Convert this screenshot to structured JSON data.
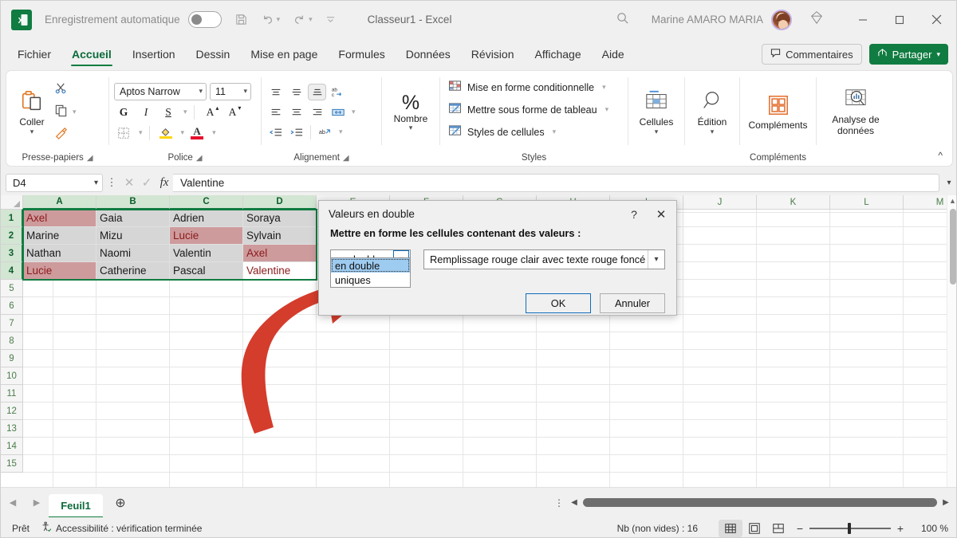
{
  "titlebar": {
    "app_icon": "excel-logo",
    "autosave_label": "Enregistrement automatique",
    "autosave_state": "off",
    "save_icon": "save-icon",
    "undo_icon": "undo-icon",
    "redo_icon": "redo-icon",
    "customize_icon": "customize-quick-access-icon",
    "document_title": "Classeur1 - Excel",
    "search_icon": "search-icon",
    "user_name": "Marine AMARO MARIA",
    "avatar": "user-avatar",
    "diamond_icon": "microsoft-365-diamond-icon",
    "minimize": "–",
    "maximize": "□",
    "close": "✕"
  },
  "ribbon_tabs": {
    "items": [
      {
        "label": "Fichier",
        "active": false
      },
      {
        "label": "Accueil",
        "active": true
      },
      {
        "label": "Insertion",
        "active": false
      },
      {
        "label": "Dessin",
        "active": false
      },
      {
        "label": "Mise en page",
        "active": false
      },
      {
        "label": "Formules",
        "active": false
      },
      {
        "label": "Données",
        "active": false
      },
      {
        "label": "Révision",
        "active": false
      },
      {
        "label": "Affichage",
        "active": false
      },
      {
        "label": "Aide",
        "active": false
      }
    ],
    "comments_label": "Commentaires",
    "share_label": "Partager",
    "share_color": "#107c41"
  },
  "ribbon": {
    "clipboard": {
      "group_label": "Presse-papiers",
      "paste_label": "Coller",
      "cut_icon": "scissors-icon",
      "copy_icon": "copy-icon",
      "format_painter_icon": "format-painter-icon",
      "launcher_icon": "dialog-launcher-icon"
    },
    "font": {
      "group_label": "Police",
      "font_name": "Aptos Narrow",
      "font_size": "11",
      "bold_label": "G",
      "italic_label": "I",
      "underline_label": "S",
      "increase_size_label": "A",
      "decrease_size_label": "A",
      "borders_icon": "borders-icon",
      "fill_color_icon": "fill-color-icon",
      "font_color_icon": "font-color-icon",
      "launcher_icon": "dialog-launcher-icon"
    },
    "alignment": {
      "group_label": "Alignement",
      "align_top_icon": "align-top-icon",
      "align_middle_icon": "align-middle-icon",
      "align_bottom_icon": "align-bottom-icon",
      "wrap_text_icon": "wrap-text-icon",
      "align_left_icon": "align-left-icon",
      "align_center_icon": "align-center-icon",
      "align_right_icon": "align-right-icon",
      "merge_icon": "merge-and-center-icon",
      "decrease_indent_icon": "decrease-indent-icon",
      "increase_indent_icon": "increase-indent-icon",
      "orientation_icon": "text-orientation-icon",
      "launcher_icon": "dialog-launcher-icon"
    },
    "number": {
      "group_label": "",
      "label": "Nombre",
      "percent_icon": "percent-icon"
    },
    "styles": {
      "group_label": "Styles",
      "items": [
        {
          "label": "Mise en forme conditionnelle",
          "icon": "conditional-formatting-icon"
        },
        {
          "label": "Mettre sous forme de tableau",
          "icon": "format-as-table-icon"
        },
        {
          "label": "Styles de cellules",
          "icon": "cell-styles-icon"
        }
      ]
    },
    "cells": {
      "label": "Cellules",
      "icon": "cells-icon"
    },
    "editing": {
      "label": "Édition",
      "icon": "editing-magnifier-icon"
    },
    "addins": {
      "group_label": "Compléments",
      "addins_label": "Compléments",
      "addins_icon": "add-ins-icon",
      "analysis_label": "Analyse de données",
      "analysis_icon": "data-analysis-icon"
    },
    "collapse_icon": "collapse-ribbon-icon"
  },
  "formula_bar": {
    "name_box": "D4",
    "cancel_icon": "cancel-icon",
    "confirm_icon": "confirm-icon",
    "fx_icon": "fx-icon",
    "formula_value": "Valentine",
    "expand_icon": "expand-formula-bar-icon"
  },
  "grid": {
    "columns": [
      "A",
      "B",
      "C",
      "D",
      "E",
      "F",
      "G",
      "H",
      "I",
      "J",
      "K",
      "L",
      "M"
    ],
    "selected_columns": [
      "A",
      "B",
      "C",
      "D"
    ],
    "rows": [
      1,
      2,
      3,
      4,
      5,
      6,
      7,
      8,
      9,
      10,
      11,
      12,
      13,
      14,
      15
    ],
    "selected_rows": [
      1,
      2,
      3,
      4
    ],
    "active_cell": "D4",
    "dup_fill": "#ce9b9d",
    "dup_text": "#8b1a1a",
    "selection_border": "#107c41",
    "data": [
      [
        {
          "v": "Axel",
          "dup": true
        },
        {
          "v": "Gaia",
          "dup": false
        },
        {
          "v": "Adrien",
          "dup": false
        },
        {
          "v": "Soraya",
          "dup": false
        }
      ],
      [
        {
          "v": "Marine",
          "dup": false
        },
        {
          "v": "Mizu",
          "dup": false
        },
        {
          "v": "Lucie",
          "dup": true
        },
        {
          "v": "Sylvain",
          "dup": false
        }
      ],
      [
        {
          "v": "Nathan",
          "dup": false
        },
        {
          "v": "Naomi",
          "dup": false
        },
        {
          "v": "Valentin",
          "dup": false
        },
        {
          "v": "Axel",
          "dup": true
        }
      ],
      [
        {
          "v": "Lucie",
          "dup": true
        },
        {
          "v": "Catherine",
          "dup": false
        },
        {
          "v": "Pascal",
          "dup": false
        },
        {
          "v": "Valentine",
          "dup": false,
          "active": true
        }
      ]
    ]
  },
  "dialog": {
    "title": "Valeurs en double",
    "help_icon": "?",
    "close_icon": "✕",
    "instruction": "Mettre en forme les cellules contenant des valeurs :",
    "value_select": {
      "selected": "en double",
      "options": [
        "en double",
        "uniques"
      ],
      "open": true,
      "highlighted_index": 0
    },
    "format_select": {
      "selected": "Remplissage rouge clair avec texte rouge foncé"
    },
    "ok_label": "OK",
    "cancel_label": "Annuler"
  },
  "sheet_tabs": {
    "prev_icon": "◀",
    "next_icon": "▶",
    "tabs": [
      {
        "label": "Feuil1",
        "active": true
      }
    ],
    "add_icon": "⊕",
    "hscroll_left": "◀",
    "hscroll_right": "▶"
  },
  "status_bar": {
    "mode": "Prêt",
    "accessibility_icon": "accessibility-icon",
    "accessibility": "Accessibilité : vérification terminée",
    "count_label": "Nb (non vides) : 16",
    "view_normal_icon": "normal-view-icon",
    "view_layout_icon": "page-layout-view-icon",
    "view_break_icon": "page-break-view-icon",
    "zoom_out": "−",
    "zoom_in": "+",
    "zoom_value": "100 %"
  },
  "annotation": {
    "arrow_color": "#d93a2b",
    "arrow_name": "red-curved-arrow-annotation"
  }
}
